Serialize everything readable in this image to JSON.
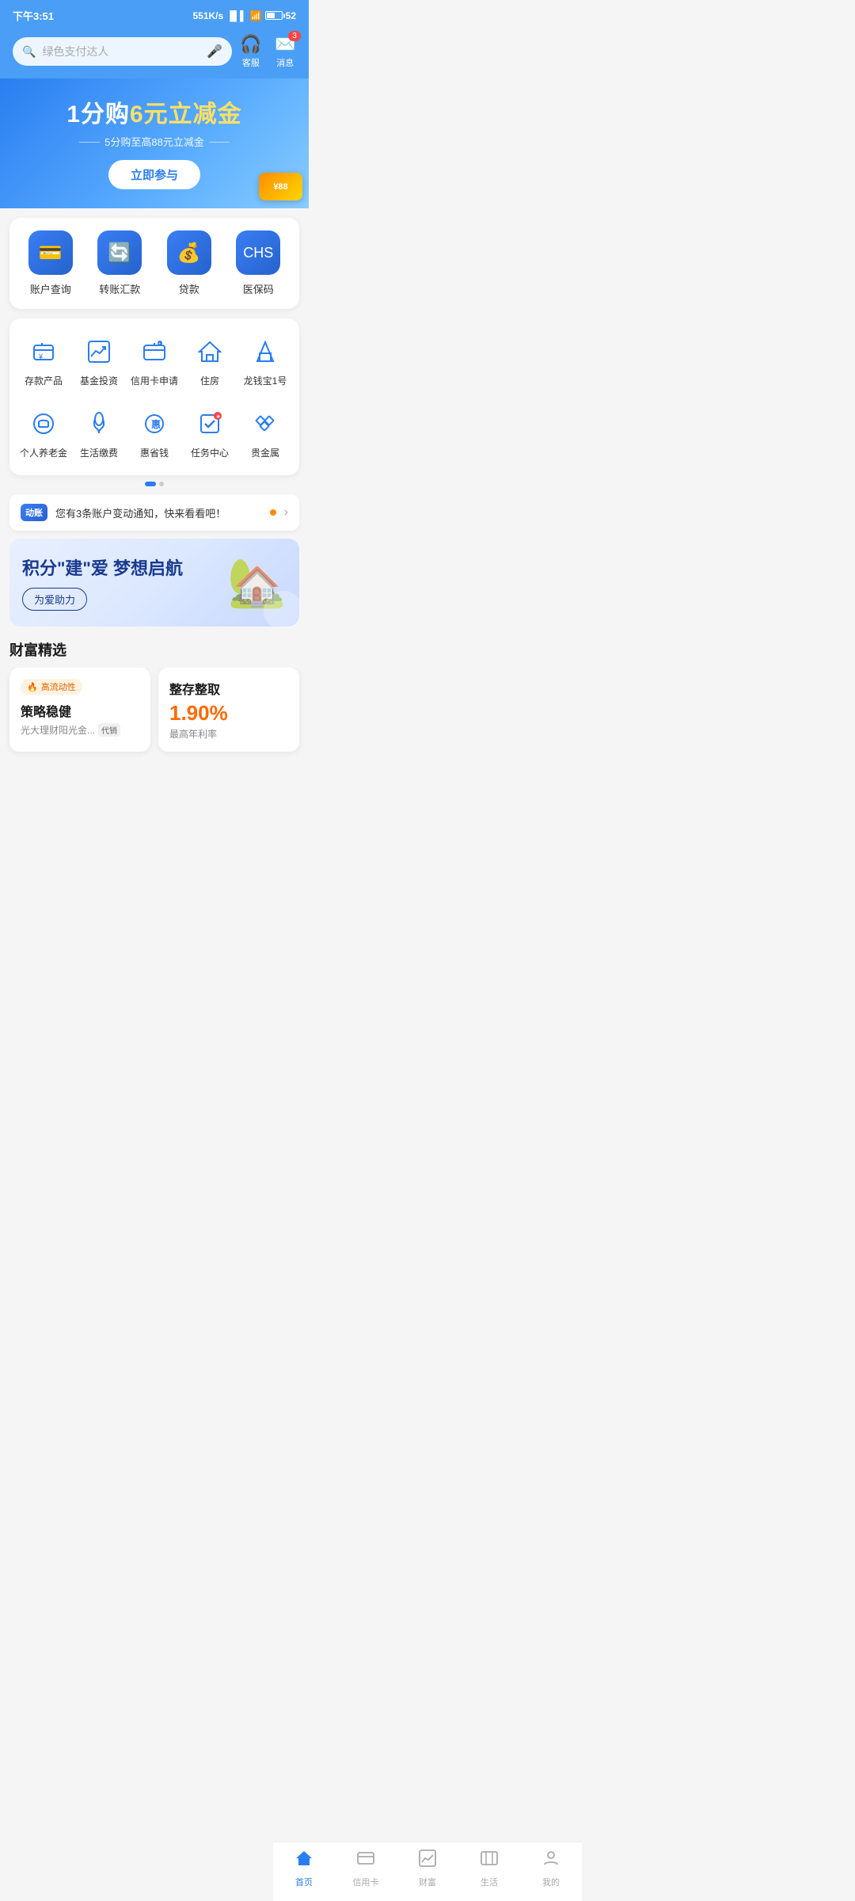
{
  "status": {
    "time": "下午3:51",
    "network": "551K/s",
    "battery": "52"
  },
  "header": {
    "search_placeholder": "绿色支付达人",
    "customer_service_label": "客服",
    "messages_label": "消息",
    "message_badge": "3"
  },
  "banner": {
    "title_prefix": "1分购",
    "title_highlight": "6元立减金",
    "subtitle": "5分购至高88元立减金",
    "button_label": "立即参与",
    "card_value": "¥88"
  },
  "quick_actions": [
    {
      "id": "account",
      "label": "账户查询",
      "icon": "💳"
    },
    {
      "id": "transfer",
      "label": "转账汇款",
      "icon": "💱"
    },
    {
      "id": "loan",
      "label": "贷款",
      "icon": "💰"
    },
    {
      "id": "medical",
      "label": "医保码",
      "icon": "🏥"
    }
  ],
  "menu_row1": [
    {
      "id": "deposit",
      "label": "存款产品",
      "icon": "¥"
    },
    {
      "id": "fund",
      "label": "基金投资",
      "icon": "📈"
    },
    {
      "id": "credit_apply",
      "label": "信用卡申请",
      "icon": "💳"
    },
    {
      "id": "housing",
      "label": "住房",
      "icon": "🏠"
    },
    {
      "id": "longqianbao",
      "label": "龙钱宝1号",
      "icon": "🏆"
    }
  ],
  "menu_row2": [
    {
      "id": "pension",
      "label": "个人养老金",
      "icon": "🛡"
    },
    {
      "id": "utilities",
      "label": "生活缴费",
      "icon": "💧"
    },
    {
      "id": "savings",
      "label": "惠省钱",
      "icon": "🎁"
    },
    {
      "id": "tasks",
      "label": "任务中心",
      "icon": "🎯"
    },
    {
      "id": "precious",
      "label": "贵金属",
      "icon": "💎"
    }
  ],
  "notification": {
    "logo": "动账",
    "text": "您有3条账户变动通知，快来看看吧！"
  },
  "promo": {
    "title": "积分\"建\"爱 梦想启航",
    "button_label": "为爱助力"
  },
  "wealth": {
    "section_title": "财富精选",
    "card1": {
      "tag": "高流动性",
      "name": "策略稳健",
      "sub": "光大理财阳光金...",
      "badge": "代销"
    },
    "card2": {
      "title": "整存整取",
      "rate": "1.90%",
      "rate_label": "最高年利率"
    }
  },
  "bottom_nav": [
    {
      "id": "home",
      "label": "首页",
      "icon": "🏠",
      "active": true
    },
    {
      "id": "credit",
      "label": "信用卡",
      "icon": "💳",
      "active": false
    },
    {
      "id": "wealth",
      "label": "财富",
      "icon": "📊",
      "active": false
    },
    {
      "id": "life",
      "label": "生活",
      "icon": "🌐",
      "active": false
    },
    {
      "id": "mine",
      "label": "我的",
      "icon": "😊",
      "active": false
    }
  ]
}
